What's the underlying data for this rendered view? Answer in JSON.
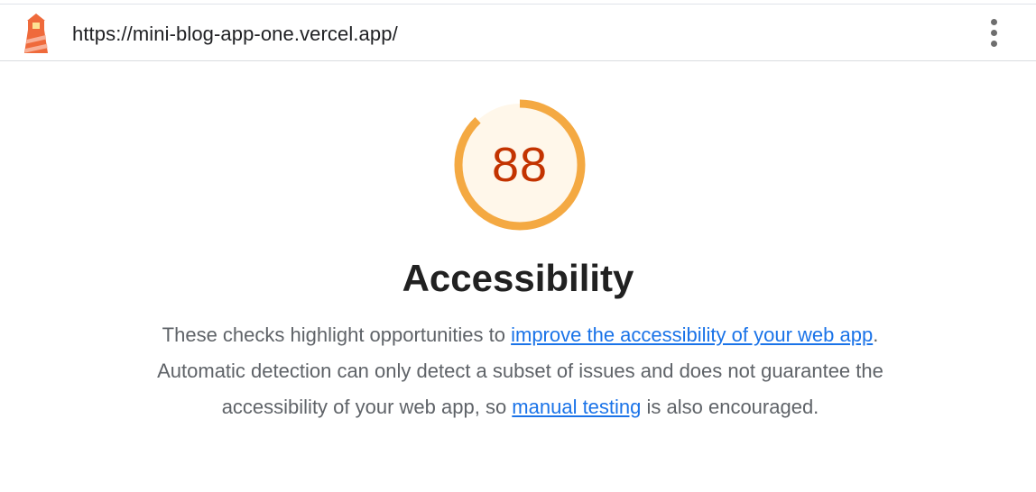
{
  "header": {
    "logo_icon": "lighthouse-icon",
    "url": "https://mini-blog-app-one.vercel.app/",
    "menu_icon": "more-vert-icon"
  },
  "category": {
    "score": "88",
    "score_fraction": 0.88,
    "title": "Accessibility",
    "description": {
      "part1": "These checks highlight opportunities to ",
      "link1": "improve the accessibility of your web app",
      "part2": ". Automatic detection can only detect a subset of issues and does not guarantee the accessibility of your web app, so ",
      "link2": "manual testing",
      "part3": " is also encouraged."
    }
  },
  "colors": {
    "gauge_stroke": "#f4a942",
    "gauge_fill": "#fff7ea",
    "score_text": "#c33300",
    "link": "#1a73e8"
  }
}
